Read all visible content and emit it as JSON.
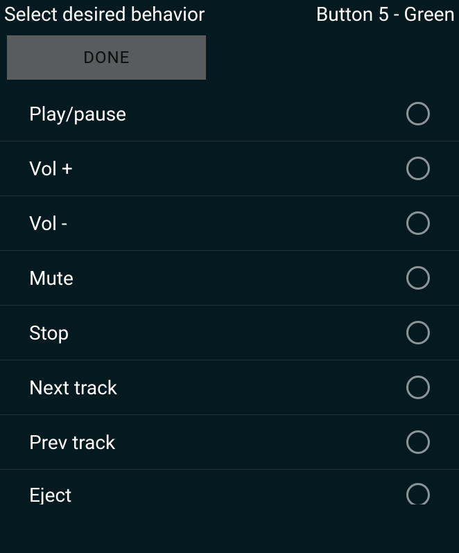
{
  "header": {
    "title": "Select desired behavior",
    "subtitle": "Button 5 - Green",
    "done_label": "DONE"
  },
  "options": [
    {
      "label": "Play/pause",
      "selected": false
    },
    {
      "label": "Vol +",
      "selected": false
    },
    {
      "label": "Vol -",
      "selected": false
    },
    {
      "label": "Mute",
      "selected": false
    },
    {
      "label": "Stop",
      "selected": false
    },
    {
      "label": "Next track",
      "selected": false
    },
    {
      "label": "Prev track",
      "selected": false
    },
    {
      "label": "Eject",
      "selected": false
    }
  ]
}
